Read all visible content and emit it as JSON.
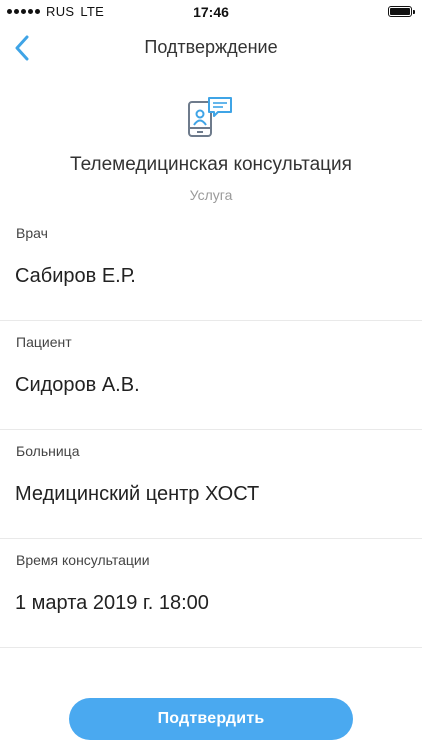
{
  "status_bar": {
    "carrier": "RUS",
    "network": "LTE",
    "time": "17:46"
  },
  "nav": {
    "title": "Подтверждение",
    "back_icon": "chevron-left-icon"
  },
  "service": {
    "icon": "telemedicine-icon",
    "title": "Телемедицинская консультация",
    "subtitle": "Услуга"
  },
  "fields": [
    {
      "label": "Врач",
      "value": "Сабиров Е.Р."
    },
    {
      "label": "Пациент",
      "value": "Сидоров А.В."
    },
    {
      "label": "Больница",
      "value": "Медицинский центр ХОСТ"
    },
    {
      "label": "Время консультации",
      "value": "1 марта 2019 г. 18:00"
    }
  ],
  "confirm_label": "Подтвердить",
  "colors": {
    "accent": "#4aa9f0",
    "icon_blue": "#3fa4e6",
    "icon_gray": "#6e7b8c"
  }
}
